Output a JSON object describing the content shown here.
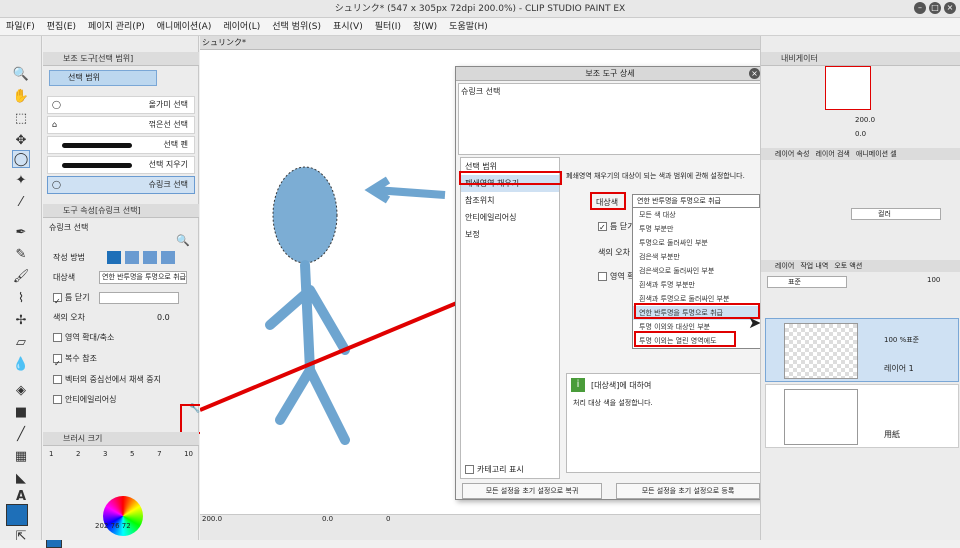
{
  "window": {
    "title": "シュリンク* (547 x 305px 72dpi 200.0%) - CLIP STUDIO PAINT EX"
  },
  "menu": [
    "파일(F)",
    "편집(E)",
    "페이지 관리(P)",
    "애니메이션(A)",
    "레이어(L)",
    "선택 범위(S)",
    "표시(V)",
    "필터(I)",
    "창(W)",
    "도움말(H)"
  ],
  "subtool": {
    "header": "보조 도구[선택 범위]",
    "group": "선택 범위",
    "items": [
      "올가미 선택",
      "꺾은선 선택",
      "선택 펜",
      "선택 지우기",
      "슈링크 선택"
    ]
  },
  "toolprop": {
    "header": "도구 속성[슈링크 선택]",
    "name": "슈링크 선택",
    "rows": [
      {
        "label": "작성 방법"
      },
      {
        "label": "대상색",
        "value": "연한 반투명을 투명으로 취급"
      },
      {
        "label": "틈 닫기"
      },
      {
        "label": "색의 오차",
        "value": "0.0"
      },
      {
        "label": "영역 확대/축소"
      },
      {
        "label": "복수 참조"
      },
      {
        "label": "벡터의 중심선에서 채색 중지"
      },
      {
        "label": "안티에일리어싱"
      }
    ]
  },
  "brushsize": {
    "header": "브러시 크기",
    "ticks": [
      "1",
      "2",
      "3",
      "5",
      "7",
      "10"
    ]
  },
  "colorinfo": {
    "r": "202",
    "g": "76",
    "b": "72"
  },
  "canvas": {
    "tab": "シュリンク*",
    "zoom": "200.0",
    "bottom_values": [
      "0.0",
      "0"
    ]
  },
  "dialog": {
    "title": "보조 도구 상세",
    "name": "슈링크 선택",
    "categories": [
      "선택 범위",
      "폐쇄영역 채우기",
      "참조위치",
      "안티에일리어싱",
      "보정"
    ],
    "desc": "폐쇄영역 채우기의 대상이 되는 색과 범위에 관해 설정합니다.",
    "target_label": "대상색",
    "target_value": "연한 반투명을 투명으로 취급",
    "close_gap": "틈 닫기",
    "color_tol": "색의 오차",
    "area_scale": "영역 확대",
    "options": [
      "모든 색 대상",
      "투명 부분만",
      "투명으로 둘러싸인 부분",
      "검은색 부분만",
      "검은색으로 둘러싸인 부분",
      "흰색과 투명 부분만",
      "흰색과 투명으로 둘러싸인 부분",
      "연한 반투명을 투명으로 취급",
      "투명 이외와 대상인 부분",
      "투명 이외는 열린 영역에도"
    ],
    "info_title": "[대상색]에 대하여",
    "info_text": "처리 대상 색을 설정합니다.",
    "show_category": "카테고리 표시",
    "reset_btn": "모든 설정을 초기 설정으로 복귀",
    "register_btn": "모든 설정을 초기 설정으로 등록"
  },
  "navigator": {
    "header": "내비게이터",
    "zoom": "200.0",
    "angle": "0.0"
  },
  "layerprop": {
    "tabs": [
      "레이어 속성",
      "레이어 검색",
      "애니메이션 셀"
    ],
    "mode": "컬러"
  },
  "layers": {
    "tabs": [
      "레이어",
      "작업 내역",
      "오토 액션"
    ],
    "blend": "표준",
    "opacity": "100",
    "items": [
      {
        "mode": "100 %표준",
        "name": "레이어 1"
      },
      {
        "name": "用紙"
      }
    ]
  },
  "colors": {
    "accent": "#1e6fb8",
    "highlight": "#e00000",
    "figure": "#6ea5d0"
  }
}
